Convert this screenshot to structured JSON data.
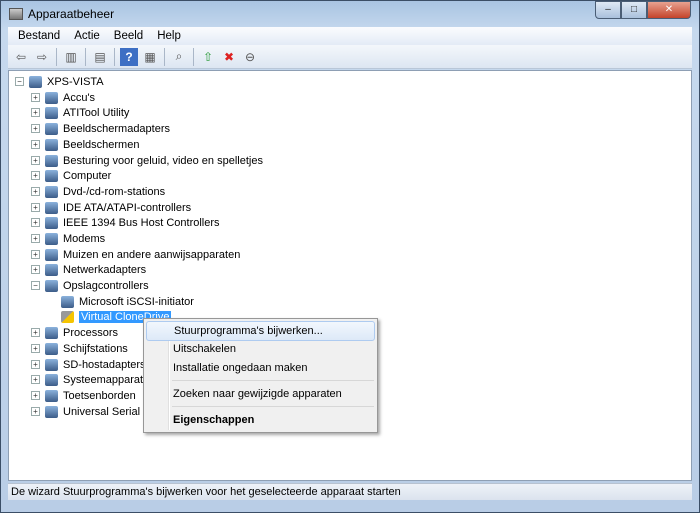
{
  "window": {
    "title": "Apparaatbeheer",
    "controls": {
      "minimize": "–",
      "maximize": "□",
      "close": "✕"
    }
  },
  "menu": [
    "Bestand",
    "Actie",
    "Beeld",
    "Help"
  ],
  "toolbar": [
    "back-icon",
    "forward-icon",
    "show-hide-console-tree-icon",
    "properties-icon",
    "help-icon",
    "action-pane-icon",
    "scan-hardware-icon",
    "update-driver-icon",
    "disable-device-icon",
    "uninstall-device-icon"
  ],
  "tree": {
    "root": "XPS-VISTA",
    "items": [
      {
        "label": "Accu's"
      },
      {
        "label": "ATITool Utility"
      },
      {
        "label": "Beeldschermadapters"
      },
      {
        "label": "Beeldschermen"
      },
      {
        "label": "Besturing voor geluid, video en spelletjes"
      },
      {
        "label": "Computer"
      },
      {
        "label": "Dvd-/cd-rom-stations"
      },
      {
        "label": "IDE ATA/ATAPI-controllers"
      },
      {
        "label": "IEEE 1394 Bus Host Controllers"
      },
      {
        "label": "Modems"
      },
      {
        "label": "Muizen en andere aanwijsapparaten"
      },
      {
        "label": "Netwerkadapters"
      },
      {
        "label": "Opslagcontrollers",
        "expanded": true,
        "children": [
          {
            "label": "Microsoft iSCSI-initiator"
          },
          {
            "label": "Virtual CloneDrive",
            "selected": true,
            "warning": true
          }
        ]
      },
      {
        "label": "Processors"
      },
      {
        "label": "Schijfstations"
      },
      {
        "label": "SD-hostadapters"
      },
      {
        "label": "Systeemapparaten"
      },
      {
        "label": "Toetsenborden"
      },
      {
        "label": "Universal Serial B"
      }
    ]
  },
  "context_menu": [
    {
      "label": "Stuurprogramma's bijwerken...",
      "highlighted": true
    },
    {
      "label": "Uitschakelen"
    },
    {
      "label": "Installatie ongedaan maken"
    },
    {
      "label": "Zoeken naar gewijzigde apparaten"
    },
    {
      "label": "Eigenschappen",
      "bold": true
    }
  ],
  "status": "De wizard Stuurprogramma's bijwerken voor het geselecteerde apparaat starten",
  "colors": {
    "selection": "#3399ff",
    "titlebar": "#b9cde6"
  }
}
